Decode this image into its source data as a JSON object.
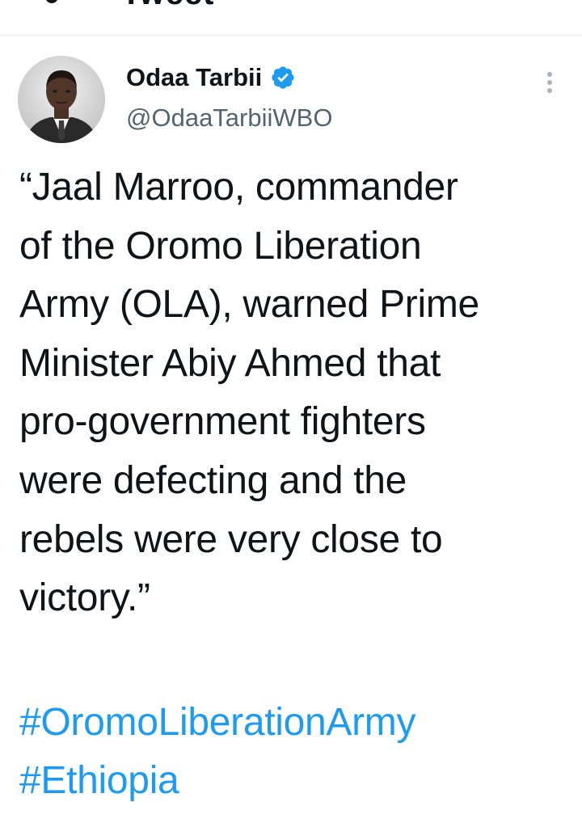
{
  "top_strip": {
    "partial_label": "Tweet"
  },
  "author": {
    "display_name": "Odaa Tarbii",
    "handle": "@OdaaTarbiiWBO",
    "verified": true,
    "avatar_icon": "profile-photo",
    "verified_icon": "verified-badge-icon"
  },
  "tweet": {
    "text": "“Jaal Marroo, commander\nof the Oromo Liberation\nArmy (OLA), warned Prime\nMinister Abiy Ahmed that\npro-government fighters\nwere defecting and the\nrebels were very close to\nvictory.”",
    "hashtags": [
      "#OromoLiberationArmy",
      "#Ethiopia"
    ]
  },
  "colors": {
    "text": "#0f1419",
    "secondary_text": "#536471",
    "link": "#1d9bf0",
    "verified": "#1d9bf0",
    "divider": "#e7e9ea"
  },
  "icons": {
    "more": "more-options-vertical-icon"
  }
}
